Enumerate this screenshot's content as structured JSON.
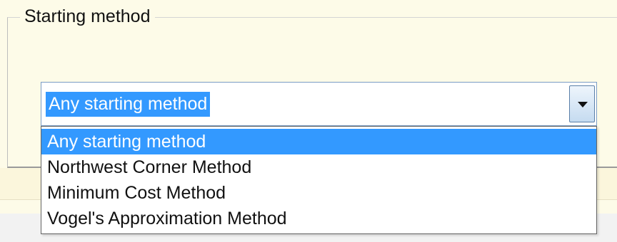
{
  "group": {
    "title": "Starting method"
  },
  "combo": {
    "selected_value": "Any starting method",
    "arrow_icon": "chevron-down-icon",
    "options": [
      {
        "label": "Any starting method",
        "selected": true
      },
      {
        "label": "Northwest Corner Method",
        "selected": false
      },
      {
        "label": "Minimum Cost Method",
        "selected": false
      },
      {
        "label": "Vogel's Approximation Method",
        "selected": false
      }
    ]
  },
  "colors": {
    "selection": "#3399ff",
    "panel_background": "#fdfbe8"
  }
}
